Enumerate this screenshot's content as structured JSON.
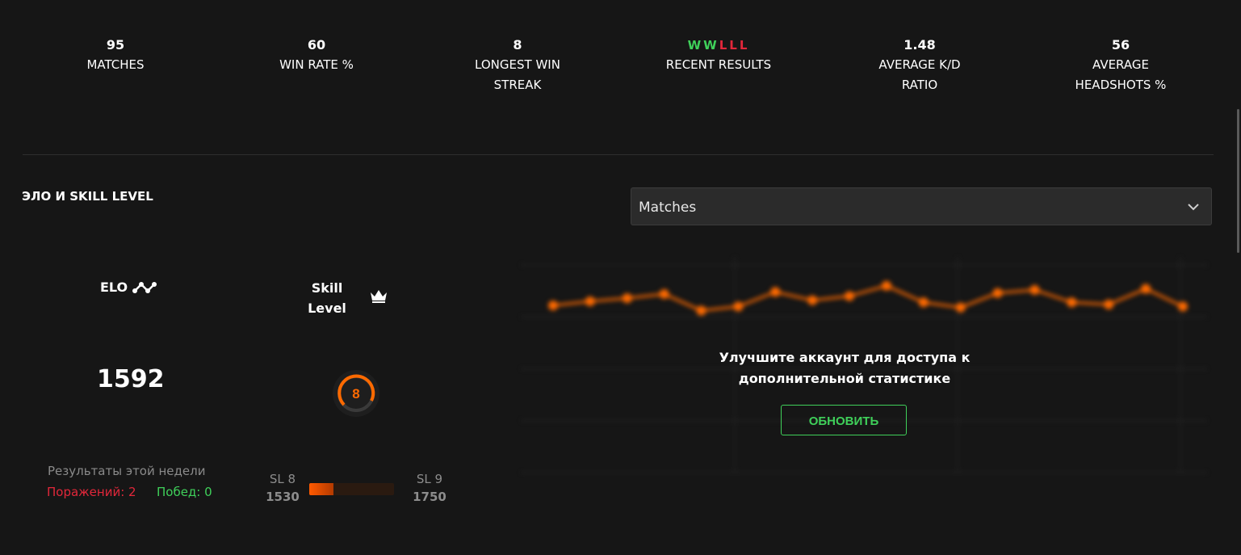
{
  "stats": [
    {
      "value": "95",
      "label": "MATCHES"
    },
    {
      "value": "60",
      "label": "WIN RATE %"
    },
    {
      "value": "8",
      "label": "LONGEST WIN STREAK"
    },
    {
      "value": "",
      "label": "RECENT RESULTS"
    },
    {
      "value": "1.48",
      "label": "AVERAGE K/D RATIO"
    },
    {
      "value": "56",
      "label": "AVERAGE HEADSHOTS %"
    }
  ],
  "recent_results": [
    "W",
    "W",
    "L",
    "L",
    "L"
  ],
  "section_title": "ЭЛО И SKILL LEVEL",
  "select": {
    "value": "Matches"
  },
  "elo": {
    "label": "ELO",
    "value": "1592"
  },
  "skill": {
    "label": "Skill Level",
    "value": "8"
  },
  "week": {
    "title": "Результаты этой недели",
    "losses": "Поражений: 2",
    "wins": "Побед: 0"
  },
  "progress": {
    "from_label": "SL 8",
    "from_value": "1530",
    "to_label": "SL 9",
    "to_value": "1750",
    "fill_fraction": 0.29
  },
  "upgrade": {
    "message": "Улучшите аккаунт для доступа к дополнительной статистике",
    "button": "ОБНОВИТЬ"
  },
  "colors": {
    "win": "#3fd05a",
    "loss": "#e2273a",
    "accent": "#ff6a00"
  },
  "chart_data": {
    "type": "line",
    "x": [
      1,
      2,
      3,
      4,
      5,
      6,
      7,
      8,
      9,
      10,
      11,
      12,
      13,
      14,
      15,
      16,
      17,
      18
    ],
    "series": [
      {
        "values": [
          1610,
          1650,
          1680,
          1720,
          1560,
          1600,
          1740,
          1660,
          1700,
          1800,
          1640,
          1590,
          1730,
          1760,
          1640,
          1620,
          1770,
          1600
        ]
      }
    ],
    "ylim": [
      0,
      2000
    ],
    "y_ticks": [
      "",
      "",
      "",
      "",
      ""
    ],
    "grid": true,
    "note_blurred": true
  }
}
